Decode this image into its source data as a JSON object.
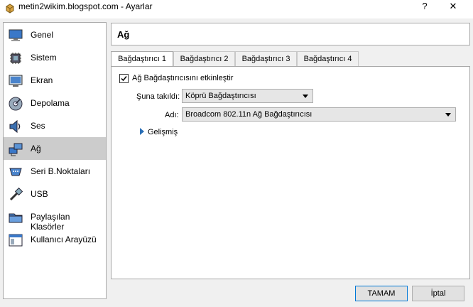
{
  "window": {
    "title": "metin2wikim.blogspot.com - Ayarlar",
    "help_label": "?",
    "close_label": "✕"
  },
  "sidebar": {
    "items": [
      {
        "label": "Genel",
        "icon": "monitor-icon"
      },
      {
        "label": "Sistem",
        "icon": "chip-icon"
      },
      {
        "label": "Ekran",
        "icon": "display-icon"
      },
      {
        "label": "Depolama",
        "icon": "disk-icon"
      },
      {
        "label": "Ses",
        "icon": "speaker-icon"
      },
      {
        "label": "Ağ",
        "icon": "network-icon",
        "selected": true
      },
      {
        "label": "Seri B.Noktaları",
        "icon": "serial-port-icon"
      },
      {
        "label": "USB",
        "icon": "usb-icon"
      },
      {
        "label": "Paylaşılan Klasörler",
        "icon": "folder-icon"
      },
      {
        "label": "Kullanıcı Arayüzü",
        "icon": "window-icon"
      }
    ]
  },
  "page": {
    "title": "Ağ"
  },
  "tabs": [
    {
      "label": "Bağdaştırıcı 1",
      "active": true
    },
    {
      "label": "Bağdaştırıcı 2"
    },
    {
      "label": "Bağdaştırıcı 3"
    },
    {
      "label": "Bağdaştırıcı 4"
    }
  ],
  "adapter": {
    "enable_label": "Ağ Bağdaştırıcısını etkinleştir",
    "enabled": true,
    "attached_label": "Şuna takıldı:",
    "attached_value": "Köprü Bağdaştırıcısı",
    "name_label": "Adı:",
    "name_value": "Broadcom 802.11n Ağ Bağdaştırıcısı",
    "advanced_label": "Gelişmiş"
  },
  "buttons": {
    "ok": "TAMAM",
    "cancel": "İptal"
  },
  "colors": {
    "selected_bg": "#cccccc",
    "accent": "#0078d7",
    "advanced_arrow": "#2b6fb6"
  }
}
